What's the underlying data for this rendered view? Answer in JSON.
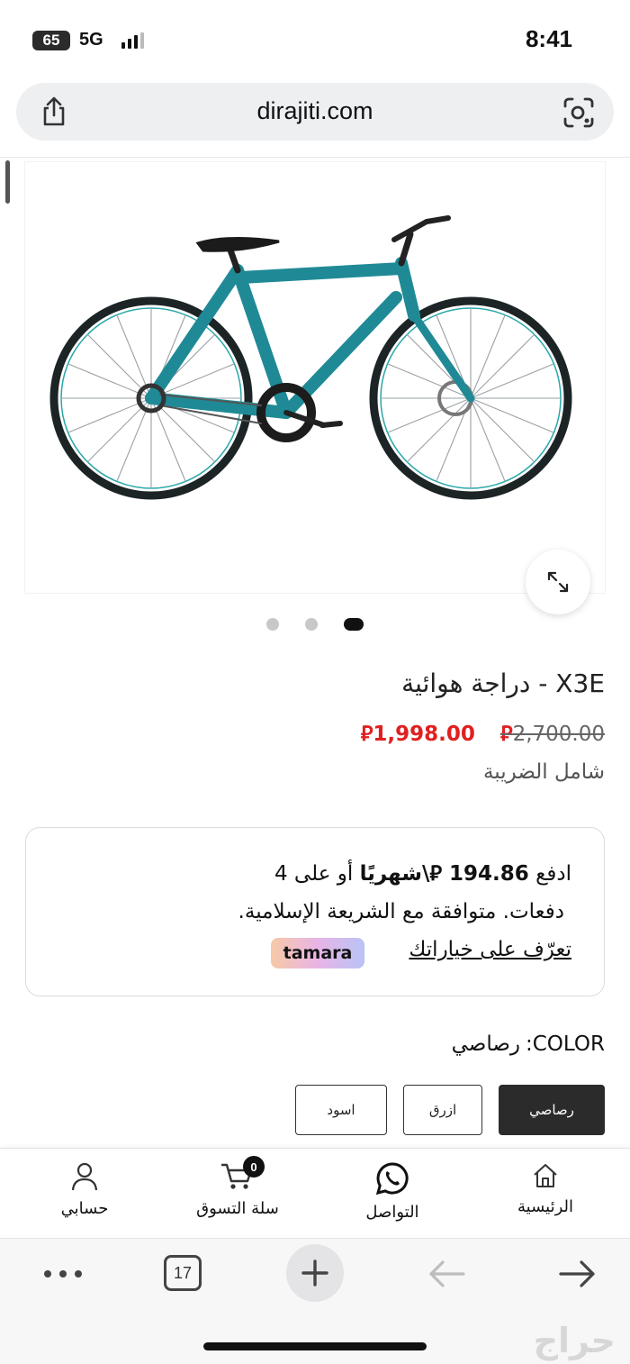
{
  "status_bar": {
    "battery": "65",
    "network": "5G",
    "time": "8:41"
  },
  "browser": {
    "url": "dirajiti.com",
    "tab_count": "17"
  },
  "product": {
    "title": "دراجة هوائية - X3E",
    "old_price": "2,700.00",
    "new_price": "1,998.00",
    "currency_symbol": "⃁",
    "tax_note": "شامل الضريبة",
    "gallery": {
      "total": 3,
      "active_index": 0
    }
  },
  "installments": {
    "pay_prefix": "ادفع",
    "amount": "194.86",
    "per_month": "\\شهريًا",
    "or_on": "أو على 4",
    "line2": "دفعات. متوافقة مع الشريعة الإسلامية.",
    "learn_more": "تعرّف على خياراتك",
    "brand": "tamara"
  },
  "color": {
    "label": "COLOR:",
    "selected_value": "رصاصي",
    "options": [
      "رصاصي",
      "ازرق",
      "اسود"
    ]
  },
  "site_nav": {
    "home": "الرئيسية",
    "contact": "التواصل",
    "cart": "سلة التسوق",
    "cart_count": "0",
    "account": "حسابي"
  },
  "watermark": "حراج",
  "colors": {
    "accent_red": "#e02020",
    "bike_teal": "#1f8a96",
    "dark": "#2b2b2b"
  }
}
